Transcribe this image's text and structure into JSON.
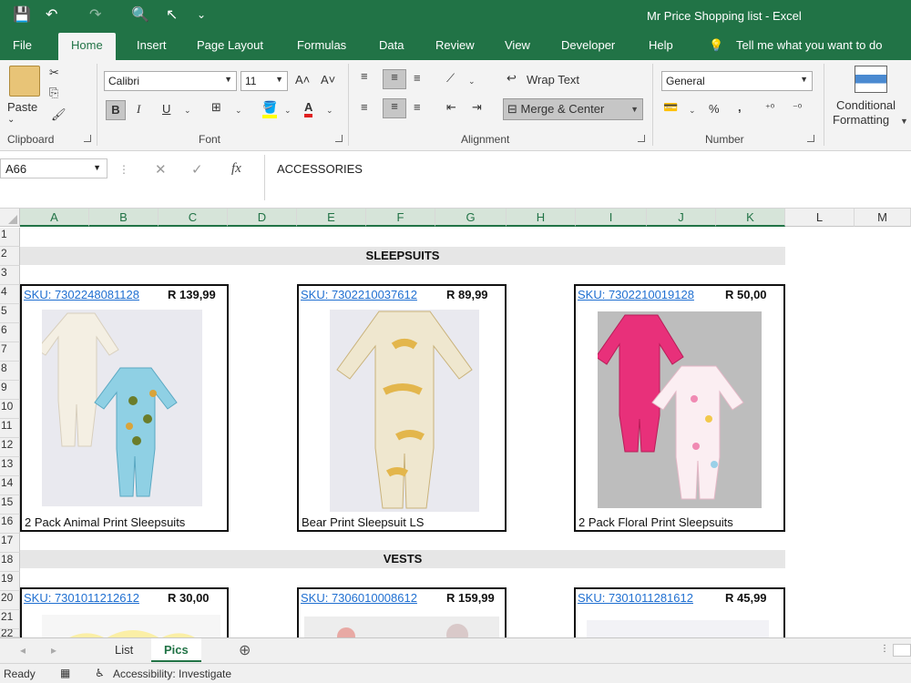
{
  "window": {
    "title": "Mr Price Shopping list  -  Excel"
  },
  "quick_access": {
    "save": "💾",
    "undo": "↶",
    "redo": "↷",
    "print_preview": "🔍",
    "touch": "↖",
    "customize": "⌄"
  },
  "tabs": [
    "File",
    "Home",
    "Insert",
    "Page Layout",
    "Formulas",
    "Data",
    "Review",
    "View",
    "Developer",
    "Help"
  ],
  "tell_me": "Tell me what you want to do",
  "ribbon": {
    "clipboard": {
      "paste": "Paste",
      "label": "Clipboard"
    },
    "font": {
      "name": "Calibri",
      "size": "11",
      "bold": "B",
      "italic": "I",
      "underline": "U",
      "grow": "A˄",
      "shrink": "A˅",
      "label": "Font"
    },
    "alignment": {
      "wrap": "Wrap Text",
      "merge": "Merge & Center",
      "label": "Alignment"
    },
    "number": {
      "format": "General",
      "percent": "%",
      "comma": ",",
      "label": "Number"
    },
    "styles": {
      "conditional_line1": "Conditional",
      "conditional_line2": "Formatting"
    }
  },
  "formula_bar": {
    "name_box": "A66",
    "cancel": "✕",
    "enter": "✓",
    "fx": "fx",
    "content": "ACCESSORIES"
  },
  "columns": [
    "A",
    "B",
    "C",
    "D",
    "E",
    "F",
    "G",
    "H",
    "I",
    "J",
    "K",
    "L",
    "M"
  ],
  "rows": [
    "1",
    "2",
    "3",
    "4",
    "5",
    "6",
    "7",
    "8",
    "9",
    "10",
    "11",
    "12",
    "13",
    "14",
    "15",
    "16",
    "17",
    "18",
    "19",
    "20",
    "21",
    "22"
  ],
  "sections": [
    {
      "title": "SLEEPSUITS",
      "items": [
        {
          "sku": "SKU: 7302248081128",
          "price": "R 139,99",
          "name": "2 Pack Animal Print Sleepsuits"
        },
        {
          "sku": "SKU: 7302210037612",
          "price": "R  89,99",
          "name": "Bear Print Sleepsuit LS"
        },
        {
          "sku": "SKU: 7302210019128",
          "price": "R  50,00",
          "name": "2 Pack Floral Print Sleepsuits"
        }
      ]
    },
    {
      "title": "VESTS",
      "items": [
        {
          "sku": "SKU: 7301011212612",
          "price": "R  30,00"
        },
        {
          "sku": "SKU: 7306010008612",
          "price": "R 159,99"
        },
        {
          "sku": "SKU: 7301011281612",
          "price": "R  45,99"
        }
      ]
    }
  ],
  "sheets": [
    "List",
    "Pics"
  ],
  "add_sheet": "⊕",
  "status": {
    "ready": "Ready",
    "accessibility": "Accessibility: Investigate"
  }
}
